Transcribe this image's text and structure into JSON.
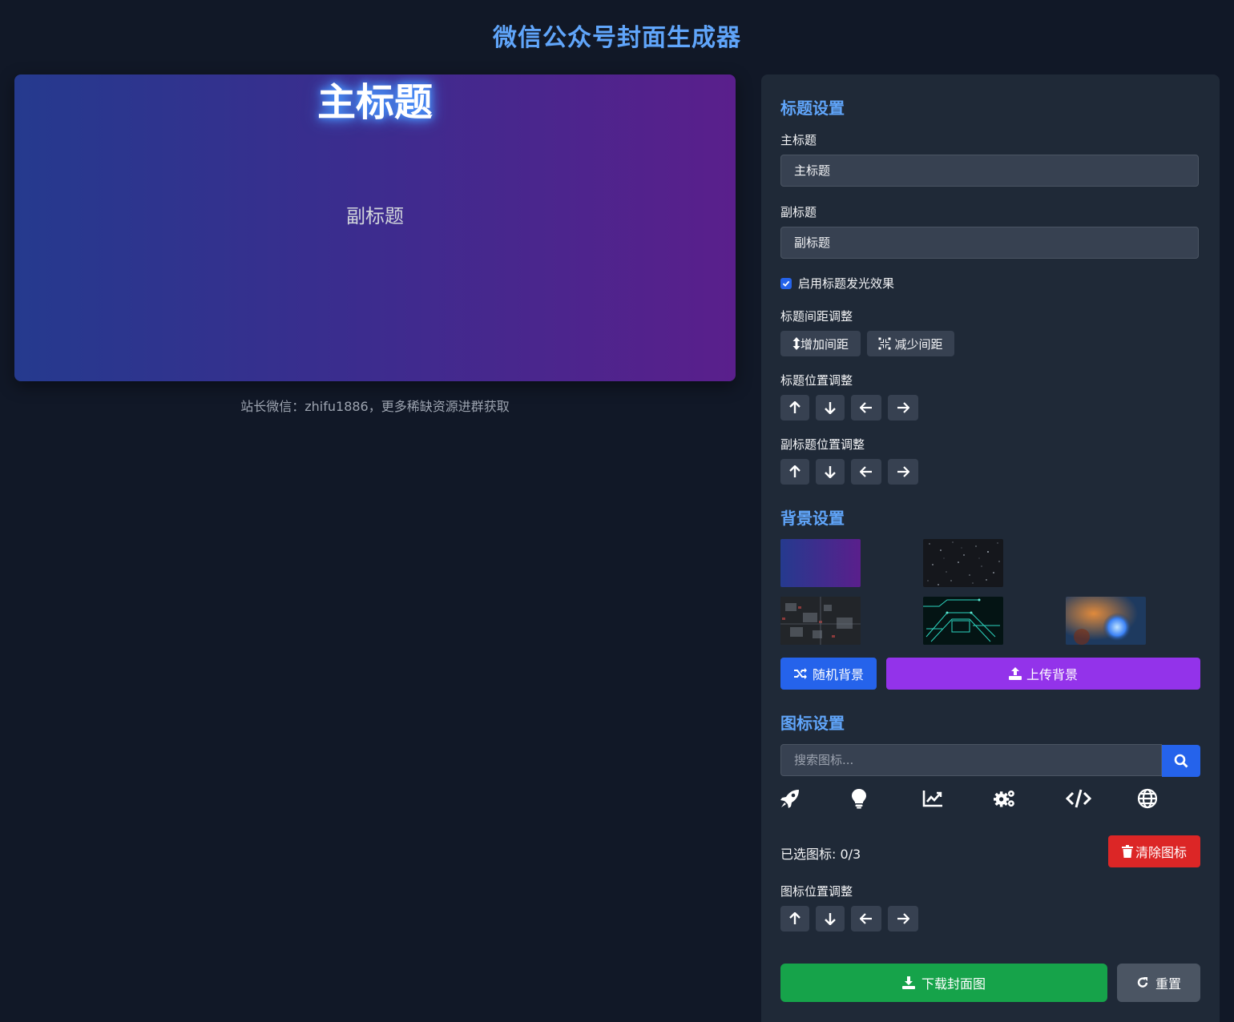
{
  "app": {
    "title": "微信公众号封面生成器"
  },
  "preview": {
    "title": "主标题",
    "subtitle": "副标题",
    "footnote": "站长微信：zhifu1886，更多稀缺资源进群获取"
  },
  "title_settings": {
    "heading": "标题设置",
    "main_title_label": "主标题",
    "main_title_value": "主标题",
    "subtitle_label": "副标题",
    "subtitle_value": "副标题",
    "glow_label": "启用标题发光效果",
    "glow_checked": true,
    "spacing_label": "标题间距调整",
    "increase_spacing": "增加间距",
    "decrease_spacing": "减少间距",
    "title_position_label": "标题位置调整",
    "subtitle_position_label": "副标题位置调整"
  },
  "background_settings": {
    "heading": "背景设置",
    "thumbnails": [
      "gradient-blue-purple",
      "starfield",
      "circuit-board-dark",
      "circuit-board-cyan",
      "nebula-space"
    ],
    "random_button": "随机背景",
    "upload_button": "上传背景"
  },
  "icon_settings": {
    "heading": "图标设置",
    "search_placeholder": "搜索图标...",
    "icons": [
      "rocket-icon",
      "lightbulb-icon",
      "chart-line-icon",
      "gears-icon",
      "code-icon",
      "globe-icon"
    ],
    "selected_count": "已选图标: 0/3",
    "clear_button": "清除图标",
    "position_label": "图标位置调整"
  },
  "actions": {
    "download": "下载封面图",
    "reset": "重置"
  },
  "colors": {
    "accent": "#60a5fa",
    "blue": "#2563eb",
    "purple": "#9333ea",
    "red": "#dc2626",
    "green": "#16a34a",
    "gray": "#4b5563"
  }
}
